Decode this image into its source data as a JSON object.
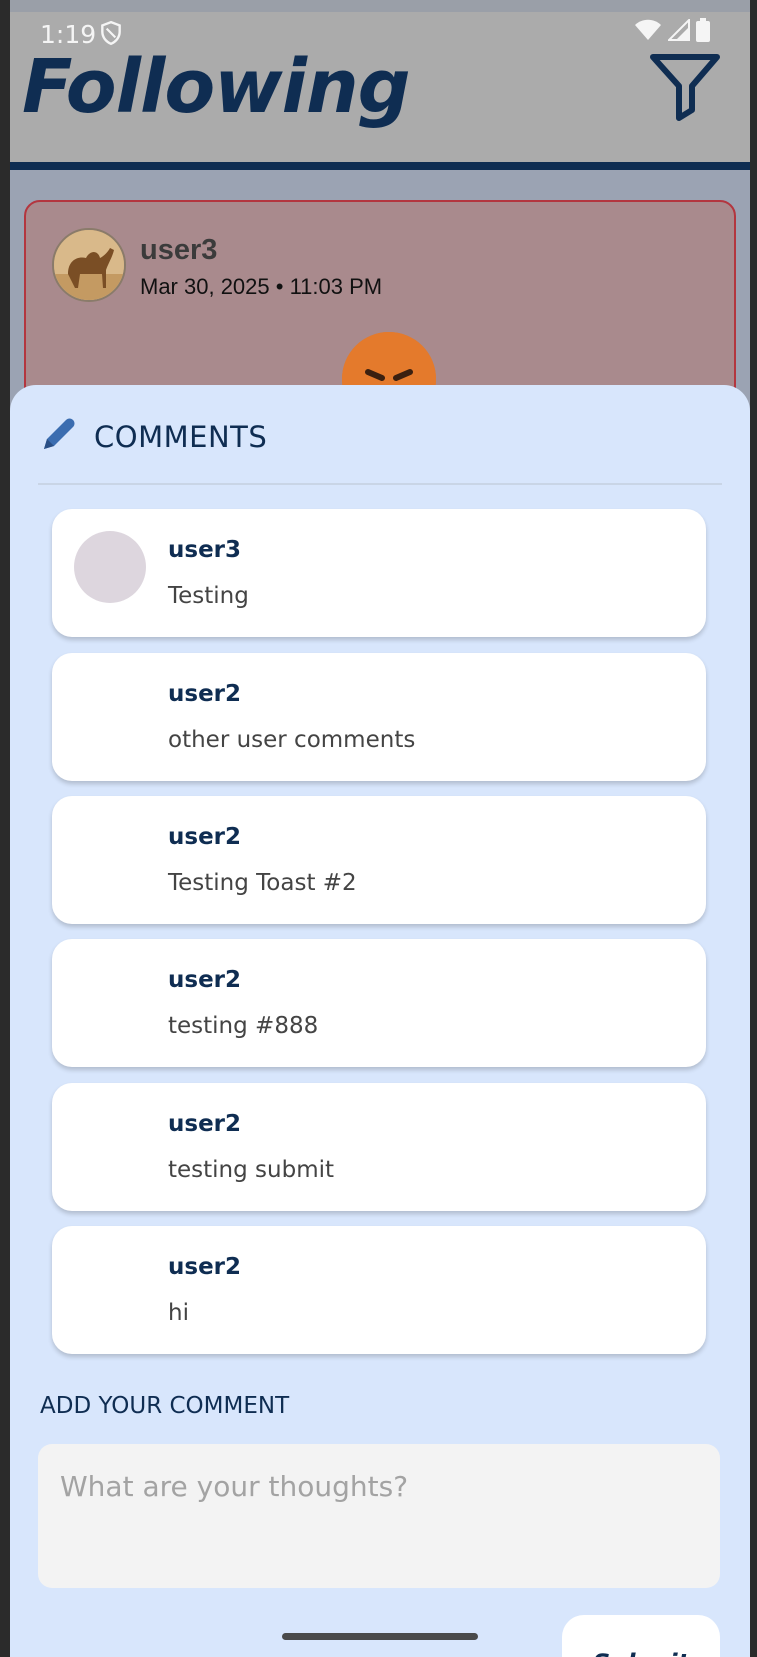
{
  "status_bar": {
    "time": "1:19"
  },
  "header": {
    "title": "Following"
  },
  "post": {
    "username": "user3",
    "datetime": "Mar 30, 2025 • 11:03 PM"
  },
  "comments_sheet": {
    "title": "COMMENTS",
    "comments": [
      {
        "user": "user3",
        "text": "Testing"
      },
      {
        "user": "user2",
        "text": "other user comments"
      },
      {
        "user": "user2",
        "text": "Testing Toast #2"
      },
      {
        "user": "user2",
        "text": "testing #888"
      },
      {
        "user": "user2",
        "text": "testing submit"
      },
      {
        "user": "user2",
        "text": "hi"
      }
    ],
    "add_label": "ADD YOUR COMMENT",
    "input": {
      "placeholder": "What are your thoughts?",
      "value": ""
    },
    "submit_label": "Submit"
  },
  "colors": {
    "primary": "#0f2d52",
    "sheet_bg": "#d8e6fc",
    "post_border": "#b3363f"
  },
  "icons": {
    "filter": "filter-icon",
    "pencil": "pencil-icon",
    "wifi": "wifi-icon",
    "signal": "signal-icon",
    "battery": "battery-icon",
    "shield": "shield-icon"
  }
}
